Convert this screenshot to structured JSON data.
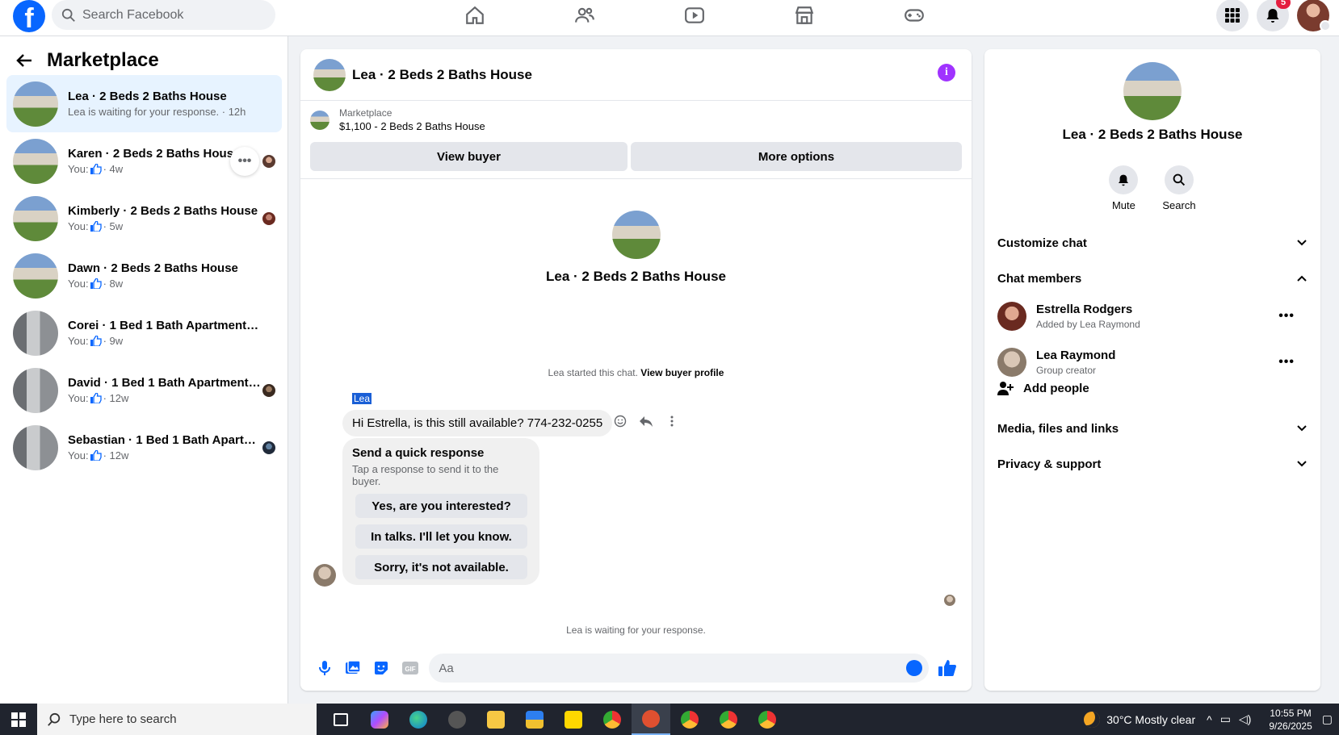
{
  "topbar": {
    "logo": "f",
    "search_placeholder": "Search Facebook",
    "nav": [
      "home-icon",
      "friends-icon",
      "video-icon",
      "marketplace-icon",
      "gaming-icon"
    ],
    "notification_count": "5"
  },
  "sidebar": {
    "title": "Marketplace",
    "conversations": [
      {
        "name": "Lea · 2 Beds 2 Baths House",
        "sub": "Lea is waiting for your response. · 12h",
        "thumb": "house"
      },
      {
        "name": "Karen · 2 Beds 2 Baths House",
        "sub_prefix": "You:",
        "time": "· 4w",
        "thumb": "house"
      },
      {
        "name": "Kimberly · 2 Beds 2 Baths House",
        "sub_prefix": "You:",
        "time": "· 5w",
        "thumb": "house"
      },
      {
        "name": "Dawn · 2 Beds 2 Baths House",
        "sub_prefix": "You:",
        "time": "· 8w",
        "thumb": "house"
      },
      {
        "name": "Corei · 1 Bed 1 Bath Apartment/co...",
        "sub_prefix": "You:",
        "time": "· 9w",
        "thumb": "apt"
      },
      {
        "name": "David · 1 Bed 1 Bath Apartment/...",
        "sub_prefix": "You:",
        "time": "· 12w",
        "thumb": "apt"
      },
      {
        "name": "Sebastian · 1 Bed 1 Bath Apartm...",
        "sub_prefix": "You:",
        "time": "· 12w",
        "thumb": "apt"
      }
    ],
    "more_label": "•••"
  },
  "chat": {
    "title": "Lea · 2 Beds 2 Baths House",
    "info": "i",
    "listing_category": "Marketplace",
    "listing_price": "$1,100 - 2 Beds 2 Baths House",
    "view_buyer": "View buyer",
    "more_options": "More options",
    "profile_name": "Lea · 2 Beds 2 Baths House",
    "started_text": "Lea started this chat.",
    "view_buyer_profile": "View buyer profile",
    "sender": "Lea",
    "message": "Hi Estrella, is this still available? 774-232-0255",
    "quick_title": "Send a quick response",
    "quick_sub": "Tap a response to send it to the buyer.",
    "quick_options": [
      "Yes, are you interested?",
      "In talks. I'll let you know.",
      "Sorry, it's not available."
    ],
    "waiting": "Lea is waiting for your response.",
    "composer_placeholder": "Aa"
  },
  "details": {
    "name": "Lea · 2 Beds 2 Baths House",
    "mute": "Mute",
    "search": "Search",
    "customize": "Customize chat",
    "members_title": "Chat members",
    "members": [
      {
        "name": "Estrella Rodgers",
        "sub": "Added by Lea Raymond"
      },
      {
        "name": "Lea Raymond",
        "sub": "Group creator"
      }
    ],
    "more_label": "•••",
    "add_people": "Add people",
    "media": "Media, files and links",
    "privacy": "Privacy & support"
  },
  "taskbar": {
    "search_placeholder": "Type here to search",
    "weather": "30°C  Mostly clear",
    "time": "10:55 PM",
    "date": "9/26/2025"
  }
}
